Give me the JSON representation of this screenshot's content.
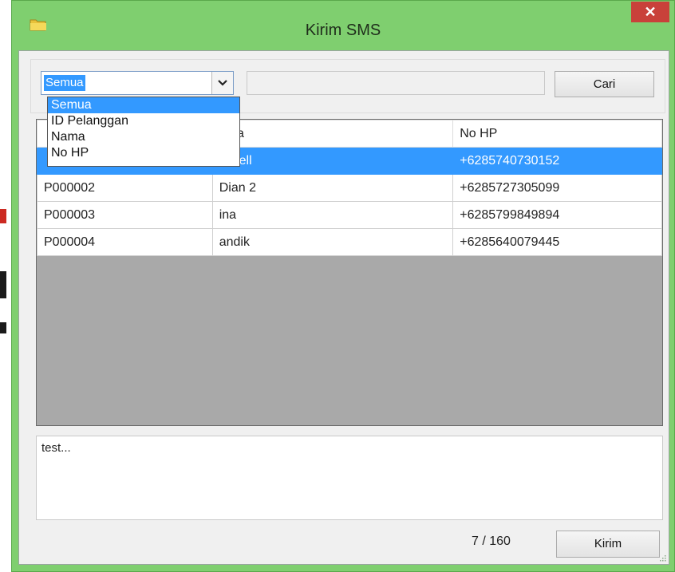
{
  "window": {
    "title": "Kirim SMS",
    "close_glyph": "✕"
  },
  "filter": {
    "selected": "Semua",
    "options": [
      "Semua",
      "ID Pelanggan",
      "Nama",
      "No HP"
    ],
    "search_value": "",
    "search_button": "Cari"
  },
  "table": {
    "headers": [
      "",
      "ama",
      "No HP"
    ],
    "rows": [
      [
        "",
        "n Cell",
        "+6285740730152"
      ],
      [
        "P000002",
        "Dian 2",
        "+6285727305099"
      ],
      [
        "P000003",
        "ina",
        "+6285799849894"
      ],
      [
        "P000004",
        "andik",
        "+6285640079445"
      ]
    ]
  },
  "message": {
    "text": "test..."
  },
  "footer": {
    "counter": "7 / 160",
    "send_button": "Kirim"
  },
  "colors": {
    "frame": "#7fcf6f",
    "selection": "#3399ff",
    "close": "#c9413a",
    "grid_bg": "#a9a9a9"
  }
}
